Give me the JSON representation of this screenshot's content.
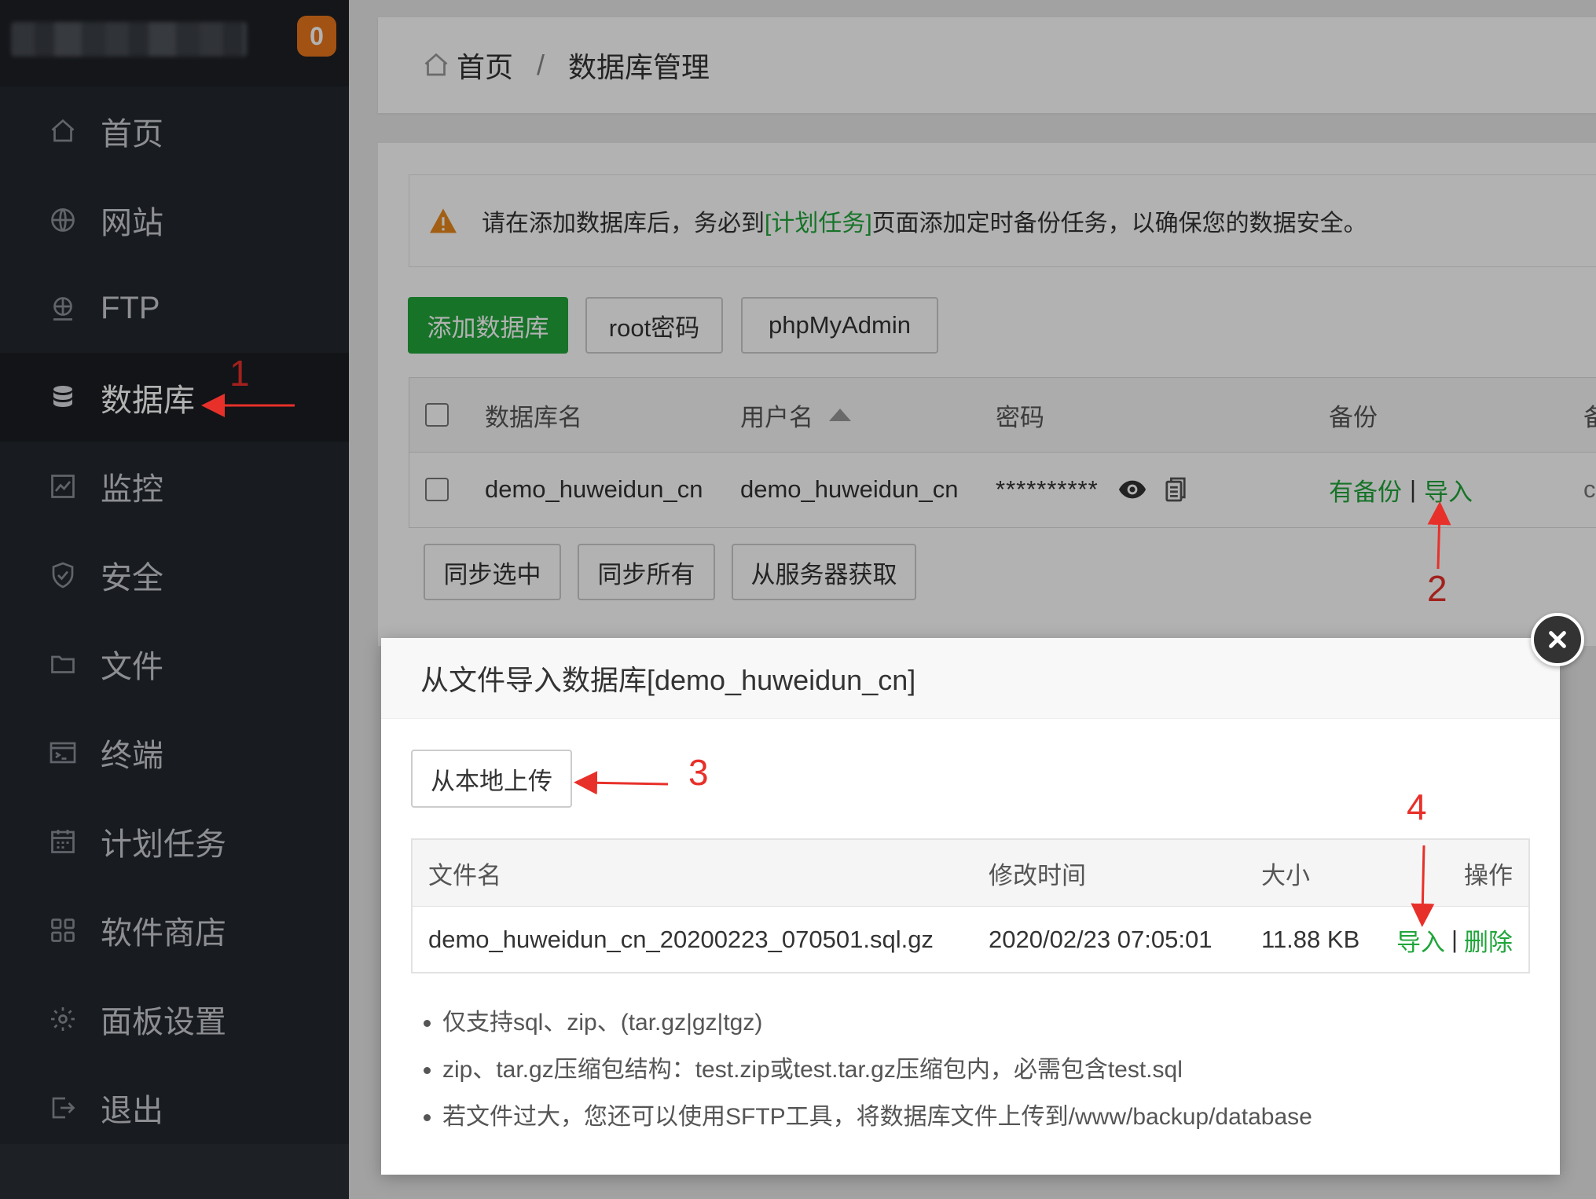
{
  "sidebar": {
    "badge": "0",
    "items": [
      {
        "label": "首页",
        "icon": "home-icon"
      },
      {
        "label": "网站",
        "icon": "globe-icon"
      },
      {
        "label": "FTP",
        "icon": "ftp-icon"
      },
      {
        "label": "数据库",
        "icon": "database-icon",
        "active": true
      },
      {
        "label": "监控",
        "icon": "monitor-icon"
      },
      {
        "label": "安全",
        "icon": "shield-icon"
      },
      {
        "label": "文件",
        "icon": "folder-icon"
      },
      {
        "label": "终端",
        "icon": "terminal-icon"
      },
      {
        "label": "计划任务",
        "icon": "calendar-icon"
      },
      {
        "label": "软件商店",
        "icon": "apps-icon"
      },
      {
        "label": "面板设置",
        "icon": "gear-icon"
      },
      {
        "label": "退出",
        "icon": "logout-icon"
      }
    ]
  },
  "breadcrumb": {
    "home": "首页",
    "separator": "/",
    "current": "数据库管理"
  },
  "alert": {
    "text_before": "请在添加数据库后，务必到",
    "link": "[计划任务]",
    "text_after": "页面添加定时备份任务，以确保您的数据安全。"
  },
  "toolbar": {
    "add_db": "添加数据库",
    "root_pw": "root密码",
    "phpmyadmin": "phpMyAdmin"
  },
  "db_table": {
    "headers": {
      "name": "数据库名",
      "user": "用户名",
      "password": "密码",
      "backup": "备份",
      "remark": "备"
    },
    "row": {
      "name": "demo_huweidun_cn",
      "user": "demo_huweidun_cn",
      "password": "**********",
      "backup_has": "有备份",
      "backup_sep": "|",
      "backup_import": "导入",
      "remark": "c"
    }
  },
  "sync": {
    "selected": "同步选中",
    "all": "同步所有",
    "from_server": "从服务器获取"
  },
  "modal": {
    "title": "从文件导入数据库[demo_huweidun_cn]",
    "upload": "从本地上传",
    "file_table": {
      "headers": {
        "filename": "文件名",
        "mtime": "修改时间",
        "size": "大小",
        "action": "操作"
      },
      "row": {
        "filename": "demo_huweidun_cn_20200223_070501.sql.gz",
        "mtime": "2020/02/23 07:05:01",
        "size": "11.88 KB",
        "import": "导入",
        "sep": "|",
        "delete": "删除"
      }
    },
    "notes": [
      "仅支持sql、zip、(tar.gz|gz|tgz)",
      "zip、tar.gz压缩包结构：test.zip或test.tar.gz压缩包内，必需包含test.sql",
      "若文件过大，您还可以使用SFTP工具，将数据库文件上传到/www/backup/database"
    ]
  },
  "annotations": {
    "step1": "1",
    "step2": "2",
    "step3": "3",
    "step4": "4"
  },
  "colors": {
    "accent_green": "#20a53a",
    "sidebar_bg": "#23272d",
    "annotation_red": "#e8302a",
    "badge_orange": "#e8761c"
  }
}
